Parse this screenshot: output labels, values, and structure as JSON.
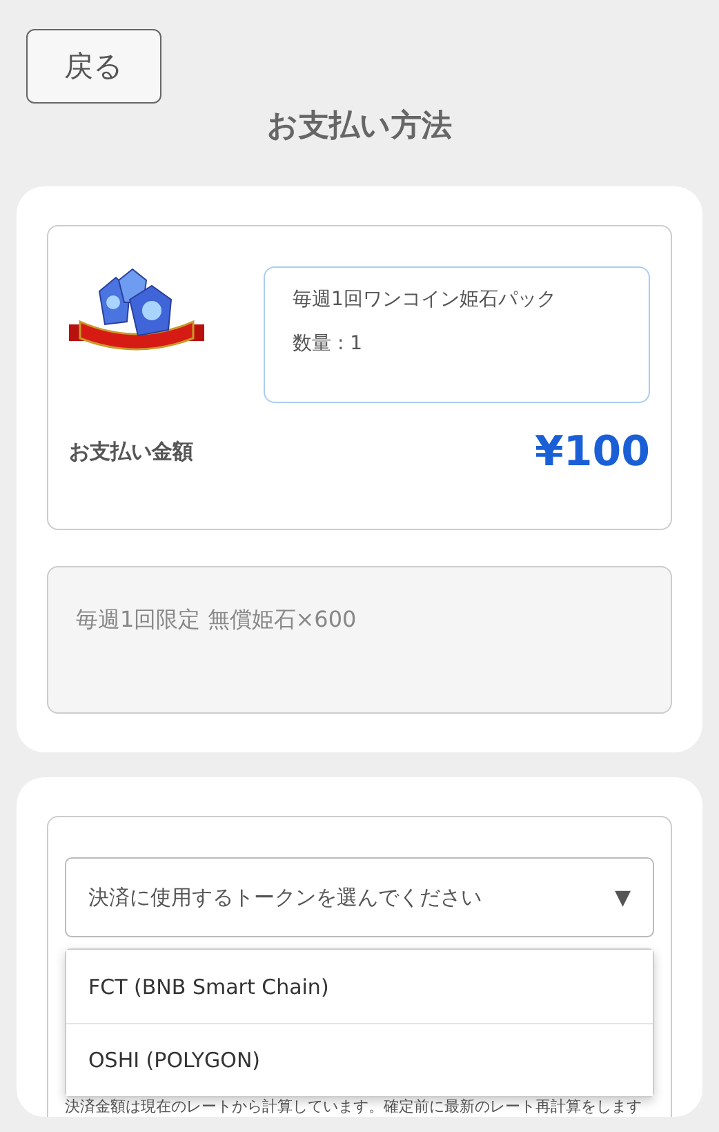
{
  "back_button": "戻る",
  "title": "お支払い方法",
  "product": {
    "name": "毎週1回ワンコイン姫石パック",
    "quantity": "数量 : 1",
    "amount_label": "お支払い金額",
    "amount": "¥100"
  },
  "description": "毎週1回限定 無償姫石×600",
  "token_select": {
    "placeholder": "決済に使用するトークンを選んでください",
    "arrow": "▼",
    "expanded": true,
    "options": [
      {
        "label": "FCT (BNB Smart Chain)",
        "selected": false
      },
      {
        "label": "OSHI (POLYGON)",
        "selected": false
      }
    ]
  },
  "note": "決済金額は現在のレートから計算しています。確定前に最新のレート再計算をします"
}
